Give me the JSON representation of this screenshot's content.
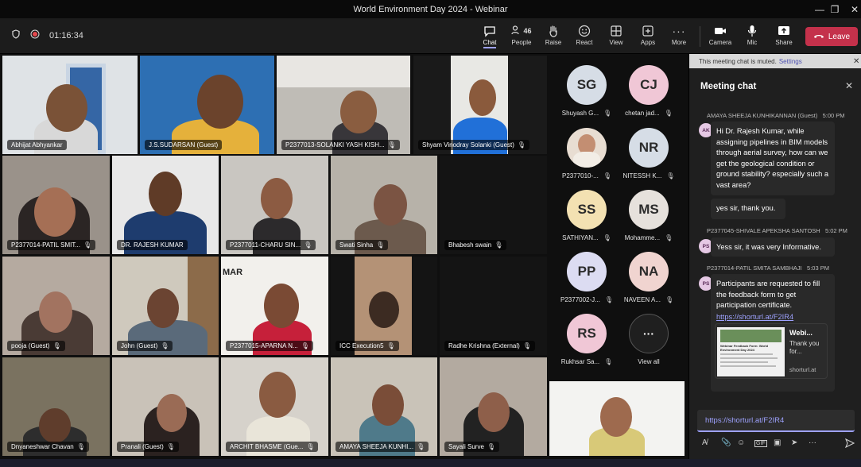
{
  "window": {
    "title": "World Environment Day 2024 - Webinar"
  },
  "toolbar": {
    "timer": "01:16:34",
    "people_count": "46",
    "buttons": {
      "chat": "Chat",
      "people": "People",
      "raise": "Raise",
      "react": "React",
      "view": "View",
      "apps": "Apps",
      "more": "More",
      "camera": "Camera",
      "mic": "Mic",
      "share": "Share",
      "leave": "Leave"
    }
  },
  "tiles": [
    {
      "name": "Abhijat Abhyankar"
    },
    {
      "name": "J.S.SUDARSAN (Guest)"
    },
    {
      "name": "P2377013-SOLANKI YASH KISH..."
    },
    {
      "name": "Shyam Vinodray Solanki (Guest)"
    },
    {
      "name": "P2377014-PATIL SMIT..."
    },
    {
      "name": "DR. RAJESH KUMAR"
    },
    {
      "name": "P2377011-CHARU SIN..."
    },
    {
      "name": "Swati Sinha"
    },
    {
      "name": "Bhabesh swain"
    },
    {
      "name": "pooja (Guest)"
    },
    {
      "name": "John (Guest)"
    },
    {
      "name": "P2377015-APARNA N..."
    },
    {
      "name": "ICC Execution5"
    },
    {
      "name": "Radhe Krishna (External)"
    },
    {
      "name": "Dnyaneshwar Chavan"
    },
    {
      "name": "Pranali (Guest)"
    },
    {
      "name": "ARCHIT BHASME (Gue..."
    },
    {
      "name": "AMAYA SHEEJA KUNHI..."
    },
    {
      "name": "Sayali Surve"
    }
  ],
  "roster": [
    {
      "initials": "SG",
      "name": "Shuyash G..."
    },
    {
      "initials": "CJ",
      "name": "chetan jad..."
    },
    {
      "initials": "",
      "name": "P2377010-..."
    },
    {
      "initials": "NR",
      "name": "NITESSH K..."
    },
    {
      "initials": "SS",
      "name": "SATHIYAN..."
    },
    {
      "initials": "MS",
      "name": "Mohamme..."
    },
    {
      "initials": "PP",
      "name": "P2377002-J..."
    },
    {
      "initials": "NA",
      "name": "NAVEEN A..."
    },
    {
      "initials": "RS",
      "name": "Rukhsar Sa..."
    },
    {
      "initials": "···",
      "name": "View all"
    }
  ],
  "chat": {
    "muted_notice": "This meeting chat is muted.",
    "settings_link": "Settings",
    "title": "Meeting chat",
    "messages": [
      {
        "sender": "AMAYA SHEEJA KUNHIKANNAN (Guest)",
        "time": "5:00 PM",
        "avatar": "AK",
        "text": "Hi Dr. Rajesh Kumar, while assigning pipelines in BIM models through aerial survey, how can we get the geological condition or ground stability? especially such a vast area?",
        "followup": "yes sir, thank you."
      },
      {
        "sender": "P2377045-SHIVALE APEKSHA SANTOSH",
        "time": "5:02 PM",
        "avatar": "PS",
        "text": "Yess sir, it was very Informative."
      },
      {
        "sender": "P2377014-PATIL SMITA SAMBHAJI",
        "time": "5:03 PM",
        "avatar": "PS",
        "text": "Participants are requested to fill the feedback form to get participation certificate.",
        "link": "https://shorturl.at/F2IR4"
      }
    ],
    "card": {
      "title": "Webi...",
      "desc": "Thank you for...",
      "source": "shorturl.at",
      "thumb_title": "Webinar Feedback Form: World Environment Day 2024"
    },
    "compose_value": "https://shorturl.at/F2IR4"
  }
}
